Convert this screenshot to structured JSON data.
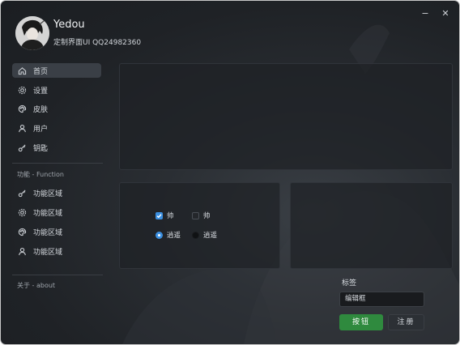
{
  "user": {
    "name": "Yedou",
    "subtitle": "定制界面UI QQ24982360"
  },
  "window_controls": {
    "minimize": "−",
    "close": "✕"
  },
  "sidebar": {
    "items": [
      {
        "label": "首页",
        "icon": "home-icon",
        "active": true
      },
      {
        "label": "设置",
        "icon": "gear-icon",
        "active": false
      },
      {
        "label": "皮肤",
        "icon": "palette-icon",
        "active": false
      },
      {
        "label": "用户",
        "icon": "user-icon",
        "active": false
      },
      {
        "label": "钥匙",
        "icon": "key-icon",
        "active": false
      }
    ],
    "section_function": "功能 - Function",
    "function_items": [
      {
        "label": "功能区域",
        "icon": "key-icon"
      },
      {
        "label": "功能区域",
        "icon": "gear-icon"
      },
      {
        "label": "功能区域",
        "icon": "palette-icon"
      },
      {
        "label": "功能区域",
        "icon": "user-icon"
      }
    ],
    "about": "关于 - about"
  },
  "controls": {
    "checkboxes": [
      {
        "label": "帅",
        "checked": true
      },
      {
        "label": "帅",
        "checked": false
      }
    ],
    "radios": [
      {
        "label": "逍遥",
        "selected": true
      },
      {
        "label": "逍遥",
        "selected": false
      }
    ]
  },
  "form": {
    "label": "标签",
    "edit_value": "编辑框",
    "primary_button": "按钮",
    "secondary_button": "注册"
  },
  "colors": {
    "accent_blue": "#3b8fe0",
    "primary_green": "#2f8a3e",
    "background": "#1f2226"
  }
}
